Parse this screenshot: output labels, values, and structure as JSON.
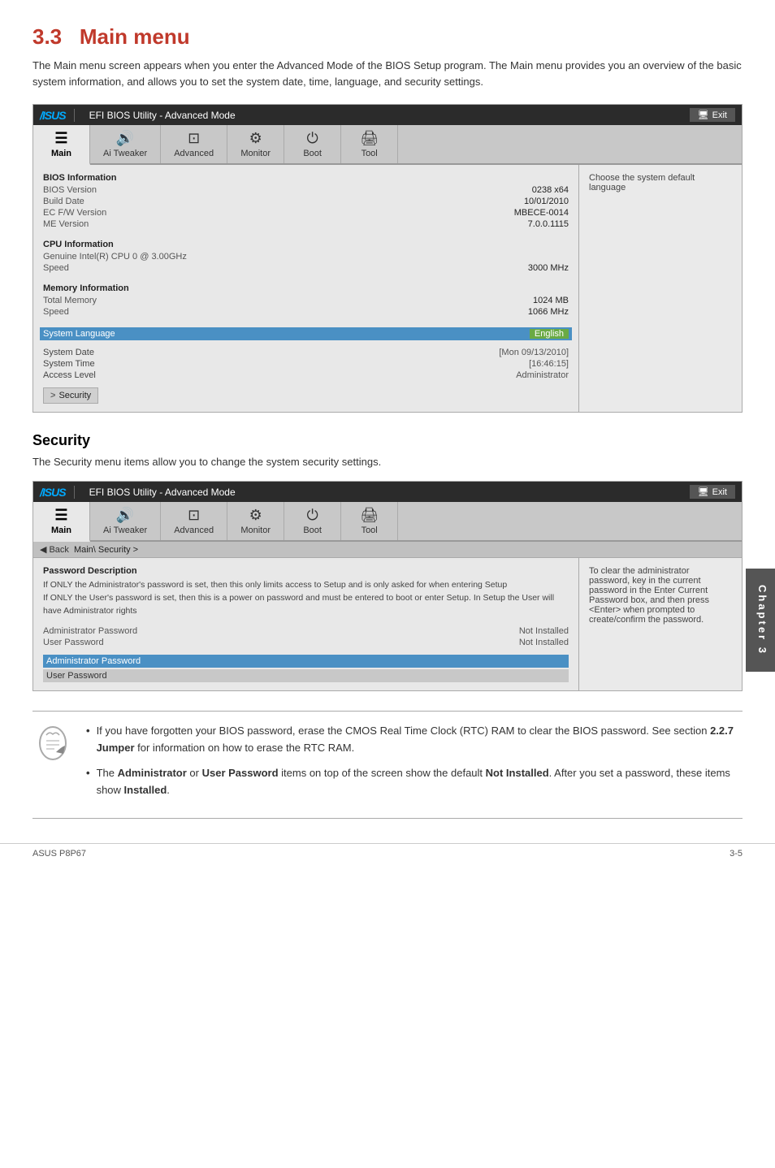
{
  "page": {
    "title": "3.3   Main menu",
    "title_number": "3.3",
    "title_main": "Main menu",
    "section1_desc": "The Main menu screen appears when you enter the Advanced Mode of the BIOS Setup program. The Main menu provides you an overview of the basic system information, and allows you to set the system date, time, language, and security settings.",
    "section2_title": "Security",
    "section2_desc": "The Security menu items allow you to change the system security settings.",
    "footer_left": "ASUS P8P67",
    "footer_right": "3-5"
  },
  "bios1": {
    "title": "EFI BIOS Utility - Advanced Mode",
    "exit_label": "Exit",
    "nav_tabs": [
      {
        "id": "main",
        "label": "Main",
        "icon": "≡",
        "active": true
      },
      {
        "id": "ai_tweaker",
        "label": "Ai Tweaker",
        "icon": "🔊"
      },
      {
        "id": "advanced",
        "label": "Advanced",
        "icon": "⊡"
      },
      {
        "id": "monitor",
        "label": "Monitor",
        "icon": "⚙"
      },
      {
        "id": "boot",
        "label": "Boot",
        "icon": "⏻"
      },
      {
        "id": "tool",
        "label": "Tool",
        "icon": "🖨"
      }
    ],
    "bios_info_title": "BIOS Information",
    "bios_version_label": "BIOS Version",
    "bios_version_value": "0238 x64",
    "build_date_label": "Build Date",
    "build_date_value": "10/01/2010",
    "ec_fw_label": "EC F/W Version",
    "ec_fw_value": "MBECE-0014",
    "me_version_label": "ME Version",
    "me_version_value": "7.0.0.1115",
    "cpu_info_title": "CPU Information",
    "cpu_model": "Genuine Intel(R) CPU 0 @ 3.00GHz",
    "cpu_speed_label": "Speed",
    "cpu_speed_value": "3000 MHz",
    "mem_info_title": "Memory Information",
    "total_memory_label": "Total Memory",
    "total_memory_value": "1024 MB",
    "mem_speed_label": "Speed",
    "mem_speed_value": "1066 MHz",
    "sys_lang_label": "System Language",
    "sys_lang_value": "English",
    "sys_date_label": "System Date",
    "sys_date_value": "[Mon 09/13/2010]",
    "sys_time_label": "System Time",
    "sys_time_value": "[16:46:15]",
    "access_level_label": "Access Level",
    "access_level_value": "Administrator",
    "security_label": "Security",
    "right_hint": "Choose the system default language"
  },
  "bios2": {
    "title": "EFI BIOS Utility - Advanced Mode",
    "exit_label": "Exit",
    "back_label": "Back",
    "breadcrumb": "Main\\  Security  >",
    "pwd_desc_title": "Password Description",
    "pwd_desc_text": "If ONLY the Administrator's password is set, then this only limits access to Setup and is only asked for when entering Setup\nIf ONLY the User's password is set, then this is a power on password and must be entered to boot or enter Setup. In Setup the User will have Administrator rights",
    "admin_pwd_label": "Administrator Password",
    "admin_pwd_value": "Not Installed",
    "user_pwd_label": "User Password",
    "user_pwd_value": "Not Installed",
    "admin_pwd_highlight": "Administrator Password",
    "user_pwd_highlight": "User Password",
    "right_hint": "To clear the administrator password, key in the current password in the Enter Current Password box, and then press <Enter> when prompted to create/confirm the password."
  },
  "notes": {
    "icon": "✒",
    "items": [
      {
        "text_parts": [
          {
            "text": "If you have forgotten your BIOS password, erase the CMOS Real Time Clock (RTC) RAM to clear the BIOS password. See section ",
            "bold": false
          },
          {
            "text": "2.2.7 Jumper",
            "bold": true
          },
          {
            "text": " for information on how to erase the RTC RAM.",
            "bold": false
          }
        ]
      },
      {
        "text_parts": [
          {
            "text": "The ",
            "bold": false
          },
          {
            "text": "Administrator",
            "bold": true
          },
          {
            "text": " or ",
            "bold": false
          },
          {
            "text": "User Password",
            "bold": true
          },
          {
            "text": " items on top of the screen show the default ",
            "bold": false
          },
          {
            "text": "Not Installed",
            "bold": true
          },
          {
            "text": ". After you set a password, these items show ",
            "bold": false
          },
          {
            "text": "Installed",
            "bold": true
          },
          {
            "text": ".",
            "bold": false
          }
        ]
      }
    ]
  }
}
